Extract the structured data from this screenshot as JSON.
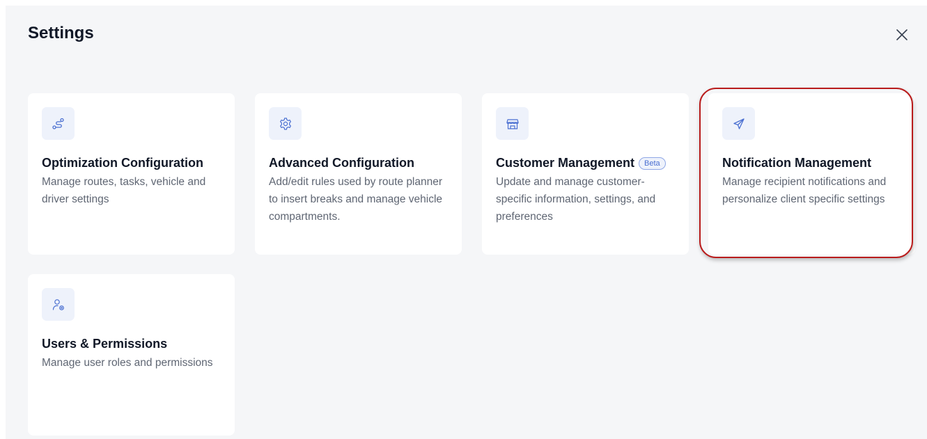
{
  "dialog": {
    "title": "Settings",
    "close_icon": "close-icon"
  },
  "cards": [
    {
      "icon": "route-icon",
      "title": "Optimization Configuration",
      "description": "Manage routes, tasks, vehicle and driver settings"
    },
    {
      "icon": "gear-icon",
      "title": "Advanced Configuration",
      "description": "Add/edit rules used by route planner to insert breaks and manage vehicle compartments."
    },
    {
      "icon": "storefront-icon",
      "title": "Customer Management",
      "badge": "Beta",
      "description": "Update and manage customer-specific information, settings, and preferences"
    },
    {
      "icon": "send-icon",
      "title": "Notification Management",
      "description": "Manage recipient notifications and personalize client specific settings"
    },
    {
      "icon": "user-gear-icon",
      "title": "Users & Permissions",
      "description": "Manage user roles and permissions"
    }
  ],
  "colors": {
    "background": "#f5f6f8",
    "card": "#ffffff",
    "icon_box": "#eef2fb",
    "icon_stroke": "#4a6fd1",
    "highlight": "#b91c1c"
  }
}
